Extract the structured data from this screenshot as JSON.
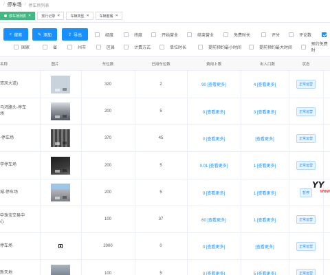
{
  "breadcrumb": {
    "current": "停车场",
    "sub": "停车场列表"
  },
  "tabs": [
    {
      "label": "停车场列表",
      "active": true
    },
    {
      "label": "放行记录",
      "active": false
    },
    {
      "label": "车辆类型",
      "active": false
    },
    {
      "label": "车辆套餐",
      "active": false
    }
  ],
  "toolbar": {
    "search_label": "搜索",
    "add_label": "添加",
    "export_label": "导出"
  },
  "column_toggles": [
    {
      "label": "经度",
      "checked": false
    },
    {
      "label": "纬度",
      "checked": false
    },
    {
      "label": "开始营业",
      "checked": false
    },
    {
      "label": "结束营业",
      "checked": false
    },
    {
      "label": "免费时长",
      "checked": false
    },
    {
      "label": "评分",
      "checked": false
    },
    {
      "label": "评论数",
      "checked": false
    },
    {
      "label": "",
      "checked": true
    },
    {
      "label": "国家",
      "checked": false
    },
    {
      "label": "省",
      "checked": false
    },
    {
      "label": "州市",
      "checked": false
    },
    {
      "label": "区县",
      "checked": false
    },
    {
      "label": "计费方式",
      "checked": false
    },
    {
      "label": "单位时长",
      "checked": false
    },
    {
      "label": "提前预约最小时间",
      "checked": false
    },
    {
      "label": "提前预约最大时间",
      "checked": false
    },
    {
      "label": "预约免费时",
      "checked": false
    }
  ],
  "table": {
    "headers": {
      "name": "名称",
      "image": "图片",
      "total": "车位数",
      "used": "已用车位数",
      "fee_limit": "费用上限",
      "entrances": "出入口数",
      "status": "状态"
    },
    "rows": [
      {
        "name": "双凤大道)",
        "thumb": "light",
        "total": "320",
        "used": "2",
        "fee": "90 [查看更多]",
        "entr": "4 [查看更多]",
        "status": "正常运营"
      },
      {
        "name": "马鸿路头-停车\n场",
        "thumb": "street",
        "total": "200",
        "used": "5",
        "fee": "0 [查看更多]",
        "entr": "3 [查看更多]",
        "status": "正常运营"
      },
      {
        "name": "-停车场",
        "thumb": "parking",
        "total": "370",
        "used": "45",
        "fee": "0 [查看更多]",
        "entr": "[查看更多]",
        "status": "正常运营"
      },
      {
        "name": "学停车场",
        "thumb": "dark",
        "total": "200",
        "used": "5",
        "fee": "0.01 [查看更多]",
        "entr": "1 [查看更多]",
        "status": "正常运营"
      },
      {
        "name": "城-停车场",
        "thumb": "bldg",
        "total": "200",
        "used": "5",
        "fee": "0 [查看更多]",
        "entr": "1 [查看更多]",
        "status": "暂停"
      },
      {
        "name": "中珠宝交易中\n心",
        "thumb": "",
        "total": "100",
        "used": "37",
        "fee": "60 [查看更多]",
        "entr": "1 [查看更多]",
        "status": "正常运营"
      },
      {
        "name": "停车场",
        "thumb": "qr",
        "total": "2000",
        "used": "0",
        "fee": "0 [查看更多]",
        "entr": "[查看更多]",
        "status": "正常运营"
      },
      {
        "name": "新天地",
        "thumb": "cars",
        "total": "100",
        "used": "5",
        "fee": "0 [查看更多]",
        "entr": "5 [查看更多]",
        "status": "正常运营"
      }
    ]
  },
  "watermark": {
    "main": "YY",
    "sub": "WWW"
  }
}
